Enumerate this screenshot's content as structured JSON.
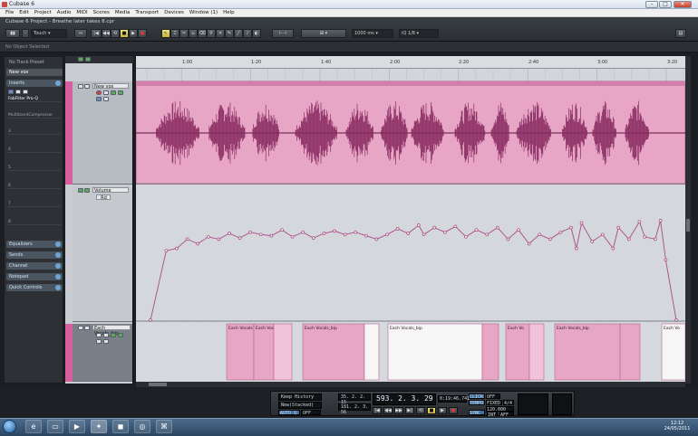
{
  "window": {
    "app_title": "Cubase 6",
    "project_title": "Cubase 6 Project - Breathe later takes 8.cpr"
  },
  "menu": [
    "File",
    "Edit",
    "Project",
    "Audio",
    "MIDI",
    "Scores",
    "Media",
    "Transport",
    "Devices",
    "Window (1)",
    "Help"
  ],
  "toolbar": {
    "automation_mode": "Touch",
    "nudge_value": "1000 ms",
    "quantize": "1/8"
  },
  "infoline": "No Object Selected",
  "inspector": {
    "preset": "No Track Preset",
    "track_name": "New vox",
    "inserts_label": "Inserts",
    "insert_1": "FabFilter Pro-Q",
    "insert_2": "MultibandCompressor",
    "slot_numbers": [
      "3",
      "4",
      "5",
      "6",
      "7",
      "8"
    ],
    "sections": [
      "Equalizers",
      "Sends",
      "Channel",
      "Notepad",
      "Quick Controls"
    ]
  },
  "tracks": [
    {
      "name": "New vox"
    },
    {
      "name": "Volume",
      "sub": "Rd"
    },
    {
      "name": "Each Vocals_bip"
    }
  ],
  "ruler": {
    "ticks": [
      "1:00",
      "1:20",
      "1:40",
      "2:00",
      "2:20",
      "2:40",
      "3:00",
      "3:20"
    ]
  },
  "regions": [
    "Each Vocals",
    "Each Voc",
    "Each Vocals_bip",
    "Each Vocals_bip",
    "Each Vo",
    "Each Vocals_bip",
    "Each Vo"
  ],
  "transport": {
    "history_1": "Keep History",
    "history_2": "New(Stacked)",
    "autoq": "AUTO Q",
    "autoq_state": "OFF",
    "left_locator": "35. 2. 2. 15",
    "right_locator": "181. 2. 3. 56",
    "position": "593. 2. 3. 29",
    "time": "0:19:46.741",
    "click": "CLICK",
    "click_state": "OFF",
    "tempo_label": "TEMPO",
    "tempo_mode": "FIXED",
    "signature": "4/4",
    "tempo": "120.000",
    "sync": "SYNC",
    "sync_state": "INT",
    "sync_rate": "AFF"
  },
  "taskbar": {
    "time": "12:12",
    "date": "24/05/2011"
  },
  "colors": {
    "track": "#d85f9e",
    "region": "#e7a6c6",
    "waveform": "#8a2c62"
  },
  "automation_curve": {
    "x_unit": "bars",
    "y_unit": "level",
    "points": [
      [
        0.0,
        0.0
      ],
      [
        0.03,
        0.6
      ],
      [
        0.05,
        0.62
      ],
      [
        0.07,
        0.7
      ],
      [
        0.09,
        0.66
      ],
      [
        0.11,
        0.72
      ],
      [
        0.13,
        0.7
      ],
      [
        0.15,
        0.75
      ],
      [
        0.17,
        0.71
      ],
      [
        0.19,
        0.76
      ],
      [
        0.21,
        0.74
      ],
      [
        0.23,
        0.73
      ],
      [
        0.25,
        0.78
      ],
      [
        0.27,
        0.72
      ],
      [
        0.29,
        0.76
      ],
      [
        0.31,
        0.71
      ],
      [
        0.33,
        0.75
      ],
      [
        0.35,
        0.77
      ],
      [
        0.37,
        0.74
      ],
      [
        0.39,
        0.76
      ],
      [
        0.41,
        0.73
      ],
      [
        0.43,
        0.7
      ],
      [
        0.45,
        0.74
      ],
      [
        0.47,
        0.79
      ],
      [
        0.49,
        0.75
      ],
      [
        0.51,
        0.82
      ],
      [
        0.52,
        0.74
      ],
      [
        0.54,
        0.8
      ],
      [
        0.56,
        0.76
      ],
      [
        0.58,
        0.81
      ],
      [
        0.6,
        0.72
      ],
      [
        0.62,
        0.78
      ],
      [
        0.64,
        0.74
      ],
      [
        0.66,
        0.8
      ],
      [
        0.68,
        0.7
      ],
      [
        0.7,
        0.78
      ],
      [
        0.72,
        0.66
      ],
      [
        0.74,
        0.74
      ],
      [
        0.76,
        0.7
      ],
      [
        0.78,
        0.76
      ],
      [
        0.8,
        0.8
      ],
      [
        0.81,
        0.62
      ],
      [
        0.82,
        0.84
      ],
      [
        0.84,
        0.68
      ],
      [
        0.86,
        0.74
      ],
      [
        0.88,
        0.62
      ],
      [
        0.89,
        0.8
      ],
      [
        0.91,
        0.7
      ],
      [
        0.93,
        0.85
      ],
      [
        0.94,
        0.72
      ],
      [
        0.96,
        0.7
      ],
      [
        0.97,
        0.86
      ],
      [
        0.98,
        0.52
      ],
      [
        1.0,
        0.0
      ]
    ]
  }
}
